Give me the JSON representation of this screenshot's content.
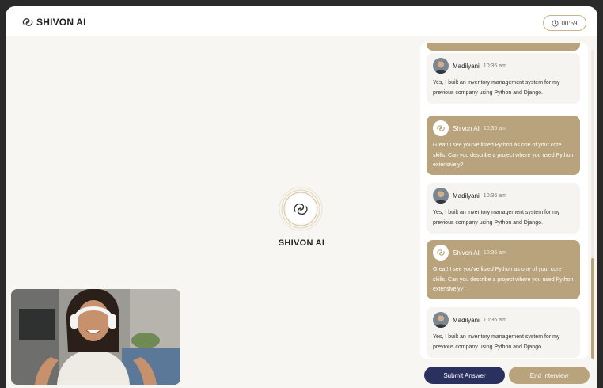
{
  "header": {
    "brand_name": "SHIVON AI",
    "timer": "00:59",
    "icons": {
      "brand": "swirl-logo-icon",
      "timer": "clock-icon"
    }
  },
  "stage": {
    "center_title": "SHIVON AI",
    "center_icon": "swirl-logo-icon"
  },
  "chat": {
    "messages": [
      {
        "role": "user",
        "sender": "Madilyani",
        "time": "10:36 am",
        "text": "Yes, I built an inventory management system for my previous company using Python and Django."
      },
      {
        "role": "ai",
        "sender": "Shivon AI",
        "time": "10:36 am",
        "text": "Great! I see you've listed Python as one of your core skills. Can you describe a project where you used Python extensively?"
      },
      {
        "role": "user",
        "sender": "Madilyani",
        "time": "10:36 am",
        "text": "Yes, I built an inventory management system for my previous company using Python and Django."
      },
      {
        "role": "ai",
        "sender": "Shivon AI",
        "time": "10:36 am",
        "text": "Great! I see you've listed Python as one of your core skills. Can you describe a project where you used Python extensively?"
      },
      {
        "role": "user",
        "sender": "Madilyani",
        "time": "10:36 am",
        "text": "Yes, I built an inventory management system for my previous company using Python and Django."
      }
    ]
  },
  "actions": {
    "submit_label": "Submit Answer",
    "end_label": "End Interview"
  },
  "colors": {
    "accent_gold": "#b9a37c",
    "navy": "#2b315e",
    "background": "#f8f6f2"
  }
}
